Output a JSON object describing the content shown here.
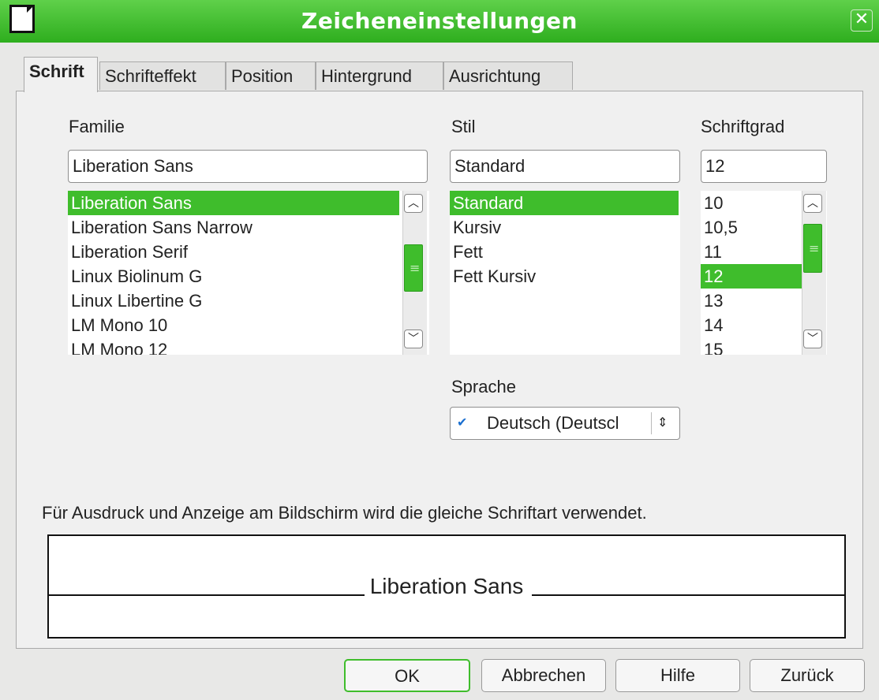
{
  "window": {
    "title": "Zeicheneinstellungen",
    "close_glyph": "✕"
  },
  "tabs": [
    {
      "label": "Schrift",
      "active": true
    },
    {
      "label": "Schrifteffekt"
    },
    {
      "label": "Position"
    },
    {
      "label": "Hintergrund"
    },
    {
      "label": "Ausrichtung"
    }
  ],
  "family": {
    "label": "Familie",
    "value": "Liberation Sans",
    "items": [
      "Liberation Sans",
      "Liberation Sans Narrow",
      "Liberation Serif",
      "Linux Biolinum G",
      "Linux Libertine G",
      "LM Mono 10",
      "LM Mono 12"
    ],
    "selected": "Liberation Sans"
  },
  "style": {
    "label": "Stil",
    "value": "Standard",
    "items": [
      "Standard",
      "Kursiv",
      "Fett",
      "Fett Kursiv"
    ],
    "selected": "Standard"
  },
  "size": {
    "label": "Schriftgrad",
    "value": "12",
    "items": [
      "10",
      "10,5",
      "11",
      "12",
      "13",
      "14",
      "15"
    ],
    "selected": "12"
  },
  "language": {
    "label": "Sprache",
    "value": "Deutsch (Deutscl",
    "icon": "spellcheck-icon"
  },
  "info_text": "Für Ausdruck und Anzeige am Bildschirm wird die gleiche Schriftart verwendet.",
  "preview": {
    "text": "Liberation Sans"
  },
  "buttons": {
    "ok": "OK",
    "cancel": "Abbrechen",
    "help": "Hilfe",
    "back": "Zurück"
  },
  "colors": {
    "accent": "#3fbd2c",
    "titlebar": "#3bb82a"
  }
}
